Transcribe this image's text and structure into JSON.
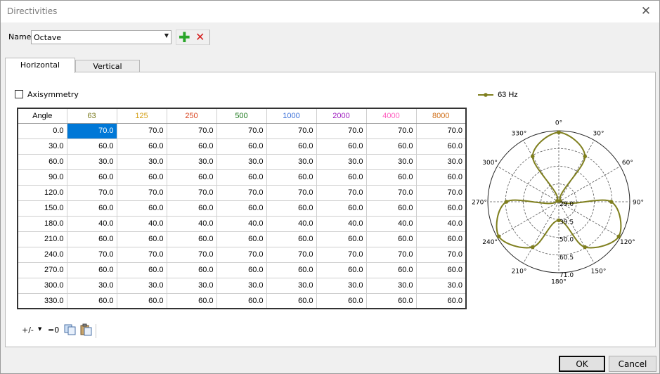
{
  "window": {
    "title": "Directivities",
    "close_glyph": "✕"
  },
  "name_row": {
    "label": "Name",
    "value": "Octave",
    "add_glyph": "✚",
    "remove_glyph": "✕"
  },
  "tabs": [
    {
      "label": "Horizontal"
    },
    {
      "label": "Vertical"
    }
  ],
  "axisymmetry": {
    "label": "Axisymmetry",
    "checked": false
  },
  "table": {
    "headers": [
      {
        "label": "Angle",
        "color": "#000000"
      },
      {
        "label": "63",
        "color": "#7a7a1e"
      },
      {
        "label": "125",
        "color": "#d4a017"
      },
      {
        "label": "250",
        "color": "#d9431e"
      },
      {
        "label": "500",
        "color": "#1e7a1e"
      },
      {
        "label": "1000",
        "color": "#3a6fd8"
      },
      {
        "label": "2000",
        "color": "#a020c0"
      },
      {
        "label": "4000",
        "color": "#ff60c0"
      },
      {
        "label": "8000",
        "color": "#d0701a"
      }
    ],
    "rows": [
      {
        "angle": "0.0",
        "values": [
          "70.0",
          "70.0",
          "70.0",
          "70.0",
          "70.0",
          "70.0",
          "70.0",
          "70.0"
        ]
      },
      {
        "angle": "30.0",
        "values": [
          "60.0",
          "60.0",
          "60.0",
          "60.0",
          "60.0",
          "60.0",
          "60.0",
          "60.0"
        ]
      },
      {
        "angle": "60.0",
        "values": [
          "30.0",
          "30.0",
          "30.0",
          "30.0",
          "30.0",
          "30.0",
          "30.0",
          "30.0"
        ]
      },
      {
        "angle": "90.0",
        "values": [
          "60.0",
          "60.0",
          "60.0",
          "60.0",
          "60.0",
          "60.0",
          "60.0",
          "60.0"
        ]
      },
      {
        "angle": "120.0",
        "values": [
          "70.0",
          "70.0",
          "70.0",
          "70.0",
          "70.0",
          "70.0",
          "70.0",
          "70.0"
        ]
      },
      {
        "angle": "150.0",
        "values": [
          "60.0",
          "60.0",
          "60.0",
          "60.0",
          "60.0",
          "60.0",
          "60.0",
          "60.0"
        ]
      },
      {
        "angle": "180.0",
        "values": [
          "40.0",
          "40.0",
          "40.0",
          "40.0",
          "40.0",
          "40.0",
          "40.0",
          "40.0"
        ]
      },
      {
        "angle": "210.0",
        "values": [
          "60.0",
          "60.0",
          "60.0",
          "60.0",
          "60.0",
          "60.0",
          "60.0",
          "60.0"
        ]
      },
      {
        "angle": "240.0",
        "values": [
          "70.0",
          "70.0",
          "70.0",
          "70.0",
          "70.0",
          "70.0",
          "70.0",
          "70.0"
        ]
      },
      {
        "angle": "270.0",
        "values": [
          "60.0",
          "60.0",
          "60.0",
          "60.0",
          "60.0",
          "60.0",
          "60.0",
          "60.0"
        ]
      },
      {
        "angle": "300.0",
        "values": [
          "30.0",
          "30.0",
          "30.0",
          "30.0",
          "30.0",
          "30.0",
          "30.0",
          "30.0"
        ]
      },
      {
        "angle": "330.0",
        "values": [
          "60.0",
          "60.0",
          "60.0",
          "60.0",
          "60.0",
          "60.0",
          "60.0",
          "60.0"
        ]
      }
    ]
  },
  "bottom_toolbar": {
    "plus_minus": "+/-",
    "dropdown_glyph": "▼",
    "zero": "=0",
    "copy_icon": "copy-icon",
    "paste_icon": "paste-icon"
  },
  "chart_data": {
    "type": "polar",
    "legend": [
      {
        "name": "63 Hz",
        "color": "#7f7f1e"
      }
    ],
    "legend_position": "top-left",
    "series": [
      {
        "name": "63 Hz",
        "angles": [
          0,
          30,
          60,
          90,
          120,
          150,
          180,
          210,
          240,
          270,
          300,
          330
        ],
        "values": [
          70,
          60,
          30,
          60,
          70,
          60,
          40,
          60,
          70,
          60,
          30,
          60
        ]
      }
    ],
    "angle_labels": [
      "0°",
      "30°",
      "60°",
      "90°",
      "120°",
      "150°",
      "180°",
      "210°",
      "240°",
      "270°",
      "300°",
      "330°"
    ],
    "radial_ticks": [
      29.0,
      39.5,
      50.0,
      60.5,
      71.0
    ],
    "radial_labels": [
      "29.0",
      "39.5",
      "50.0",
      "60.5",
      "71.0"
    ],
    "rlim": [
      29.0,
      71.0
    ]
  },
  "buttons": {
    "ok": "OK",
    "cancel": "Cancel"
  }
}
